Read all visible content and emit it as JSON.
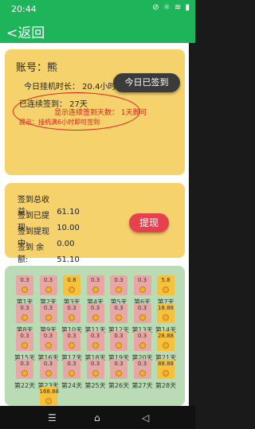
{
  "status": {
    "time": "20:44",
    "icons": "⊘ ☼ ≋ ▮"
  },
  "appbar": {
    "back_label": "<返回"
  },
  "account": {
    "label": "账号：熊",
    "hours": "今日挂机时长：  20.4小时",
    "btn": "今日已签到",
    "signed": "已连续签到：  27天",
    "tip1": "显示连续签到天数：  1天即可",
    "tip2": "提示：挂机满6小时即可签到"
  },
  "wallet": {
    "rows": [
      {
        "label": "签到总收益:",
        "value": "61.10"
      },
      {
        "label": "签到已提现:",
        "value": "10.00"
      },
      {
        "label": "签到提现中:",
        "value": "0.00"
      },
      {
        "label": "签到  余额:",
        "value": "51.10"
      }
    ],
    "btn": "提现"
  },
  "days": [
    {
      "label": "第1天",
      "amt": "0.3",
      "claimed": false
    },
    {
      "label": "第2天",
      "amt": "0.3",
      "claimed": false
    },
    {
      "label": "第3天",
      "amt": "0.8",
      "claimed": true
    },
    {
      "label": "第4天",
      "amt": "0.3",
      "claimed": false
    },
    {
      "label": "第5天",
      "amt": "0.3",
      "claimed": false
    },
    {
      "label": "第6天",
      "amt": "0.3",
      "claimed": false
    },
    {
      "label": "第7天",
      "amt": "5.8",
      "claimed": true
    },
    {
      "label": "第8天",
      "amt": "0.3",
      "claimed": false
    },
    {
      "label": "第9天",
      "amt": "0.3",
      "claimed": false
    },
    {
      "label": "第10天",
      "amt": "0.3",
      "claimed": false
    },
    {
      "label": "第11天",
      "amt": "0.3",
      "claimed": false
    },
    {
      "label": "第12天",
      "amt": "0.3",
      "claimed": false
    },
    {
      "label": "第13天",
      "amt": "0.3",
      "claimed": false
    },
    {
      "label": "第14天",
      "amt": "18.88",
      "claimed": true
    },
    {
      "label": "第15天",
      "amt": "0.3",
      "claimed": false
    },
    {
      "label": "第16天",
      "amt": "0.3",
      "claimed": false
    },
    {
      "label": "第17天",
      "amt": "0.3",
      "claimed": false
    },
    {
      "label": "第18天",
      "amt": "0.3",
      "claimed": false
    },
    {
      "label": "第19天",
      "amt": "0.3",
      "claimed": false
    },
    {
      "label": "第20天",
      "amt": "0.3",
      "claimed": false
    },
    {
      "label": "第21天",
      "amt": "28.88",
      "claimed": true
    },
    {
      "label": "第22天",
      "amt": "0.3",
      "claimed": false
    },
    {
      "label": "第23天",
      "amt": "0.3",
      "claimed": false
    },
    {
      "label": "第24天",
      "amt": "0.3",
      "claimed": false
    },
    {
      "label": "第25天",
      "amt": "0.3",
      "claimed": false
    },
    {
      "label": "第26天",
      "amt": "0.3",
      "claimed": false
    },
    {
      "label": "第27天",
      "amt": "0.3",
      "claimed": false
    },
    {
      "label": "第28天",
      "amt": "88.88",
      "claimed": true
    },
    {
      "label": "",
      "amt": "",
      "claimed": false
    },
    {
      "label": "",
      "amt": "168.88",
      "claimed": true
    }
  ],
  "navbar": {
    "menu": "☰",
    "home": "⌂",
    "back": "◁"
  }
}
